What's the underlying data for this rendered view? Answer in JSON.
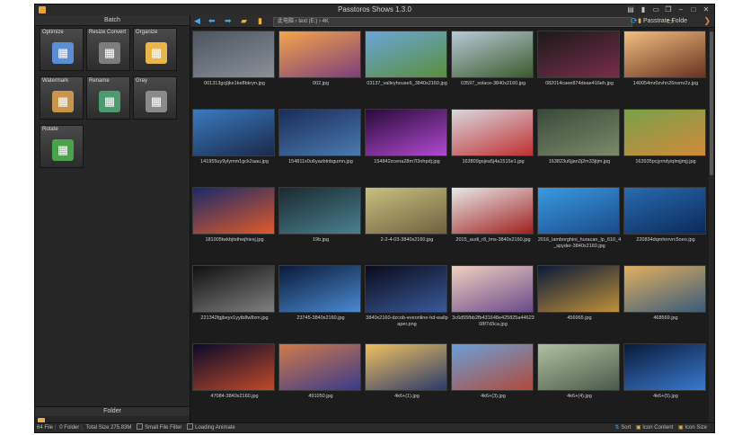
{
  "window": {
    "title": "Passtoros Shows 1.3.0"
  },
  "left_panel": {
    "header": "Batch",
    "tiles": [
      {
        "label": "Optimize",
        "icon": "optimize-icon",
        "color": "#5a8fd8"
      },
      {
        "label": "Resize Convert",
        "icon": "resize-convert-icon",
        "color": "#7d7d7d"
      },
      {
        "label": "Organize",
        "icon": "organize-icon",
        "color": "#e8b64a"
      },
      {
        "label": "Watermark",
        "icon": "watermark-icon",
        "color": "#c8954a"
      },
      {
        "label": "Rename",
        "icon": "rename-icon",
        "color": "#4d9a6f"
      },
      {
        "label": "Gray",
        "icon": "gray-icon",
        "color": "#8a8a8a"
      },
      {
        "label": "Rotate",
        "icon": "rotate-icon",
        "color": "#4aa34a"
      }
    ],
    "folder_header": "Folder"
  },
  "toolbar": {
    "address": "此电脑 › text (E:) › 4K",
    "folder_label": "Passtrate Folde"
  },
  "thumbnails": [
    {
      "name": "001313gcjljke1ke8bkryn.jpg",
      "c1": "#4c5560",
      "c2": "#8a9098"
    },
    {
      "name": "002.jpg",
      "c1": "#f4a54b",
      "c2": "#7d3e7a"
    },
    {
      "name": "03137_valleyhouse6_3840x2160.jpg",
      "c1": "#6aa6d8",
      "c2": "#5a8e3c"
    },
    {
      "name": "03597_solace-3840x2160.jpg",
      "c1": "#b8c9d8",
      "c2": "#3c5a2c"
    },
    {
      "name": "082014caee874deae416eh.jpg",
      "c1": "#1a1a1a",
      "c2": "#7a2d4a"
    },
    {
      "name": "140054mr0zvhn26nsmr2z.jpg",
      "c1": "#f0c080",
      "c2": "#6a3020"
    },
    {
      "name": "141955uy9ylymm1gck2aau.jpg",
      "c1": "#3a7ac0",
      "c2": "#1a2a4a"
    },
    {
      "name": "154811x0u6yazbtnbgumn.jpg",
      "c1": "#1a2c5a",
      "c2": "#4a7ab0"
    },
    {
      "name": "154842zcena28m7l3nhpdj.jpg",
      "c1": "#2a0a3a",
      "c2": "#b04ad0"
    },
    {
      "name": "163809gsjea5j4a1515e1.jpg",
      "c1": "#d8d8e0",
      "c2": "#c03030"
    },
    {
      "name": "163823u6jjan3j2m33jtjm.jpg",
      "c1": "#3a4a3a",
      "c2": "#7a8a6a"
    },
    {
      "name": "163935pcjyrndyiqlmjjmjj.jpg",
      "c1": "#7aa04a",
      "c2": "#d08a3a"
    },
    {
      "name": "181005twkbjtsthwjhiexj.jpg",
      "c1": "#1a2a6a",
      "c2": "#e05a2a"
    },
    {
      "name": "19b.jpg",
      "c1": "#1a2a30",
      "c2": "#4a8090"
    },
    {
      "name": "2-2-4-03-3840x2160.jpg",
      "c1": "#c8c080",
      "c2": "#706040"
    },
    {
      "name": "2015_audi_r8_lms-3840x2160.jpg",
      "c1": "#e8e8e8",
      "c2": "#a02020"
    },
    {
      "name": "2016_lamborghini_huracan_lp_610_4_spyder-3840x2160.jpg",
      "c1": "#3a9ae0",
      "c2": "#1a4a8a"
    },
    {
      "name": "220834dqmhnrvrc5oeo.jpg",
      "c1": "#2a6ab0",
      "c2": "#0a2a5a"
    },
    {
      "name": "221342fgjbeyx1yytb8w8xm.jpg",
      "c1": "#101010",
      "c2": "#808080"
    },
    {
      "name": "23745-3840x2160.jpg",
      "c1": "#0a1a3a",
      "c2": "#4a8ad0"
    },
    {
      "name": "3840x2160-dzcob-eveonline-hd-wallpaper.png",
      "c1": "#0a0a1a",
      "c2": "#3a5a9a"
    },
    {
      "name": "3c6d55fbb2fb431648e425825a4462308f7d3ca.jpg",
      "c1": "#f0d0c0",
      "c2": "#6a4a8a"
    },
    {
      "name": "456965.jpg",
      "c1": "#0a1a3a",
      "c2": "#c0903a"
    },
    {
      "name": "468569.jpg",
      "c1": "#e0b060",
      "c2": "#3a5a7a"
    },
    {
      "name": "47084-3840x2160.jpg",
      "c1": "#0a0a2a",
      "c2": "#c04a2a"
    },
    {
      "name": "491050.jpg",
      "c1": "#d07a4a",
      "c2": "#3a3a8a"
    },
    {
      "name": "4k6+(1).jpg",
      "c1": "#f0c060",
      "c2": "#2a3a6a"
    },
    {
      "name": "4k6+(3).jpg",
      "c1": "#6aa0d8",
      "c2": "#b04a3a"
    },
    {
      "name": "4k6+(4).jpg",
      "c1": "#b0c0a0",
      "c2": "#4a5a4a"
    },
    {
      "name": "4k6+(5).jpg",
      "c1": "#0a1a3a",
      "c2": "#3a7ad0"
    }
  ],
  "status": {
    "files": "64 File",
    "folders": "0 Folder",
    "total": "Total Size 275.83M",
    "small_filter": "Small File Filter",
    "loading": "Loading Animate",
    "sort": "Sort",
    "icon_content": "Icon Content",
    "icon_size": "Icon Size"
  },
  "colors": {
    "accent": "#49a6e8",
    "folder": "#e6b04a",
    "background": "#1c1c1c"
  }
}
